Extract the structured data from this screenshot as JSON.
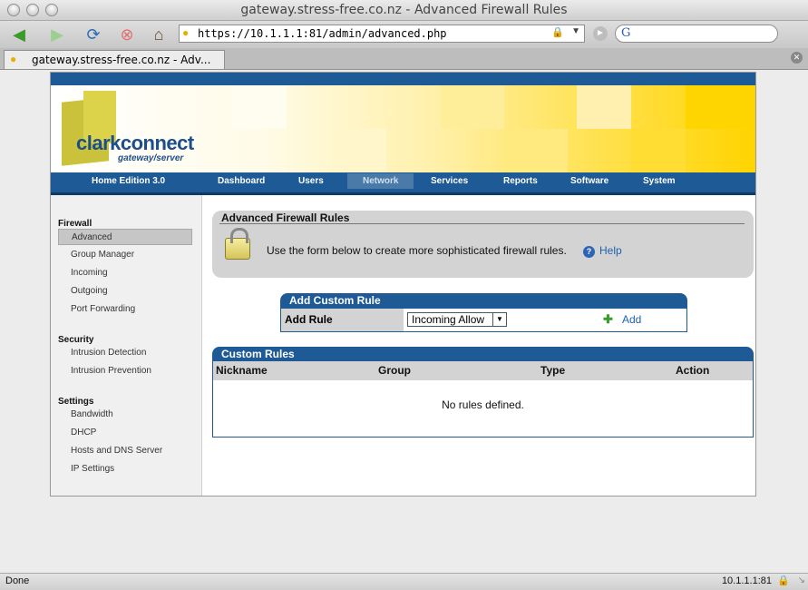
{
  "window": {
    "title": "gateway.stress-free.co.nz - Advanced Firewall Rules"
  },
  "browser": {
    "url": "https://10.1.1.1:81/admin/advanced.php",
    "tab_label": "gateway.stress-free.co.nz - Adv...",
    "search_logo": "G"
  },
  "brand": {
    "name": "clarkconnect",
    "subtitle": "gateway/server",
    "edition": "Home Edition 3.0"
  },
  "nav": {
    "items": [
      "Dashboard",
      "Users",
      "Network",
      "Services",
      "Reports",
      "Software",
      "System"
    ],
    "active": "Network"
  },
  "sidebar": {
    "sections": [
      {
        "title": "Firewall",
        "items": [
          "Advanced",
          "Group Manager",
          "Incoming",
          "Outgoing",
          "Port Forwarding"
        ]
      },
      {
        "title": "Security",
        "items": [
          "Intrusion Detection",
          "Intrusion Prevention"
        ]
      },
      {
        "title": "Settings",
        "items": [
          "Bandwidth",
          "DHCP",
          "Hosts and DNS Server",
          "IP Settings"
        ]
      }
    ],
    "active_item": "Advanced"
  },
  "panel": {
    "title": "Advanced Firewall Rules",
    "description": "Use the form below to create more sophisticated firewall rules.",
    "help_label": "Help"
  },
  "add_rule": {
    "title": "Add Custom Rule",
    "label": "Add Rule",
    "selected": "Incoming Allow",
    "add_label": "Add"
  },
  "custom_rules": {
    "title": "Custom Rules",
    "columns": [
      "Nickname",
      "Group",
      "Type",
      "Action"
    ],
    "empty_message": "No rules defined."
  },
  "status": {
    "left": "Done",
    "right": "10.1.1.1:81"
  },
  "colors": {
    "nav_blue": "#1e5a96",
    "link_blue": "#1d62b0",
    "banner_yellow": "#ffd400"
  }
}
